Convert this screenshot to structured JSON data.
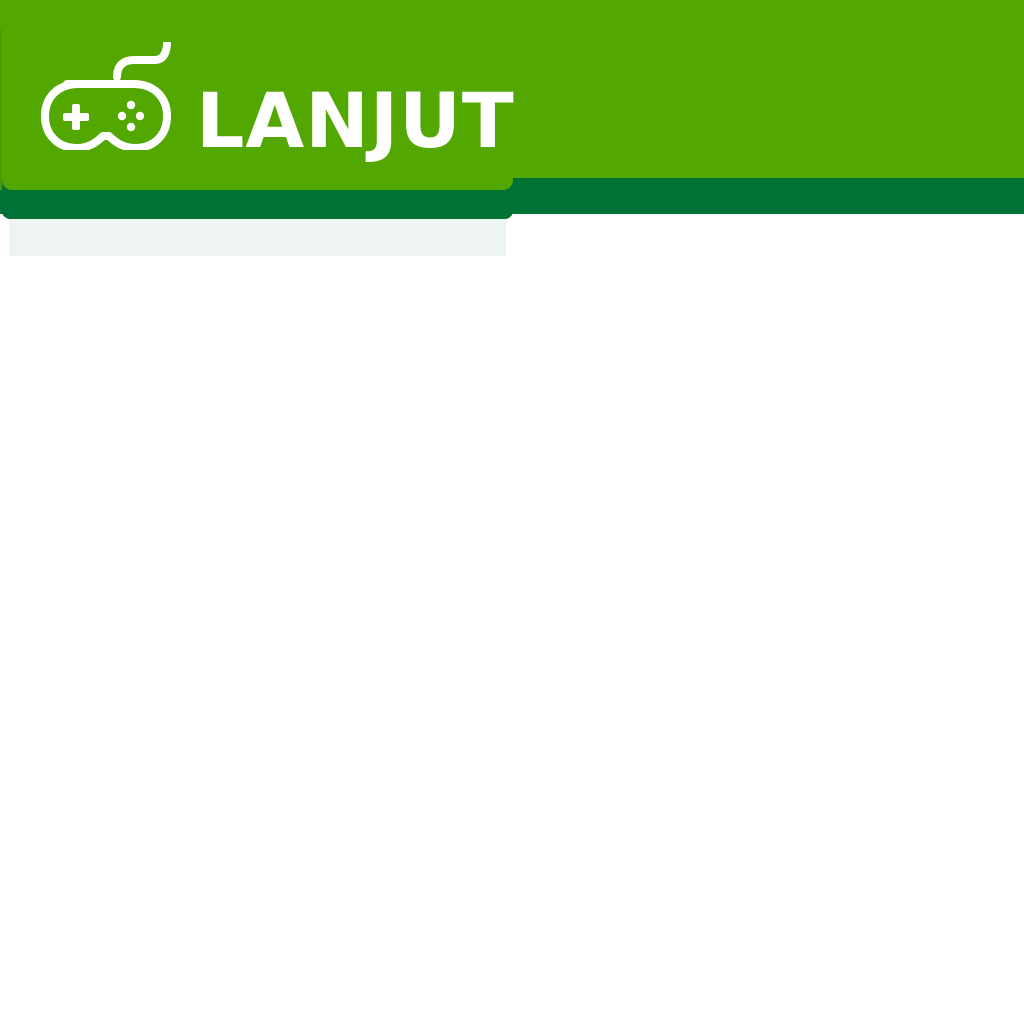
{
  "header": {
    "brand": "LANJUT",
    "logo_icon": "gamepad-icon",
    "colors": {
      "primary": "#52a800",
      "secondary": "#007235",
      "text": "#ffffff",
      "placeholder": "#eef5f0"
    }
  }
}
